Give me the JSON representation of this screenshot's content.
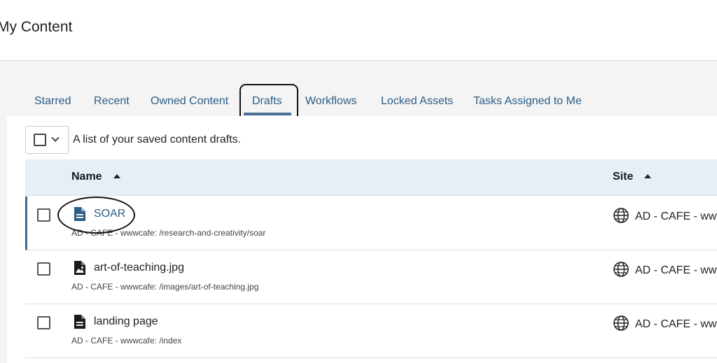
{
  "page": {
    "title": "My Content"
  },
  "tabs": [
    {
      "label": "Starred"
    },
    {
      "label": "Recent"
    },
    {
      "label": "Owned Content"
    },
    {
      "label": "Drafts",
      "active": true
    },
    {
      "label": "Workflows"
    },
    {
      "label": "Locked Assets"
    },
    {
      "label": "Tasks Assigned to Me"
    }
  ],
  "toolbar": {
    "description": "A list of your saved content drafts."
  },
  "table": {
    "columns": [
      {
        "label": "Name",
        "sort": "ascending"
      },
      {
        "label": "Site",
        "sort": "ascending"
      }
    ],
    "rows": [
      {
        "title": "SOAR",
        "path": "AD - CAFE - wwwcafe: /research-and-creativity/soar",
        "site": "AD - CAFE - www",
        "icon": "document-icon",
        "selected": true
      },
      {
        "title": "art-of-teaching.jpg",
        "path": "AD - CAFE - wwwcafe: /images/art-of-teaching.jpg",
        "site": "AD - CAFE - www",
        "icon": "image-file-icon"
      },
      {
        "title": "landing page",
        "path": "AD - CAFE - wwwcafe: /index",
        "site": "AD - CAFE - www",
        "icon": "document-icon"
      }
    ]
  },
  "colors": {
    "accent": "#2c5d86",
    "header_bg": "#e6eef6",
    "annotation": "#111111"
  }
}
